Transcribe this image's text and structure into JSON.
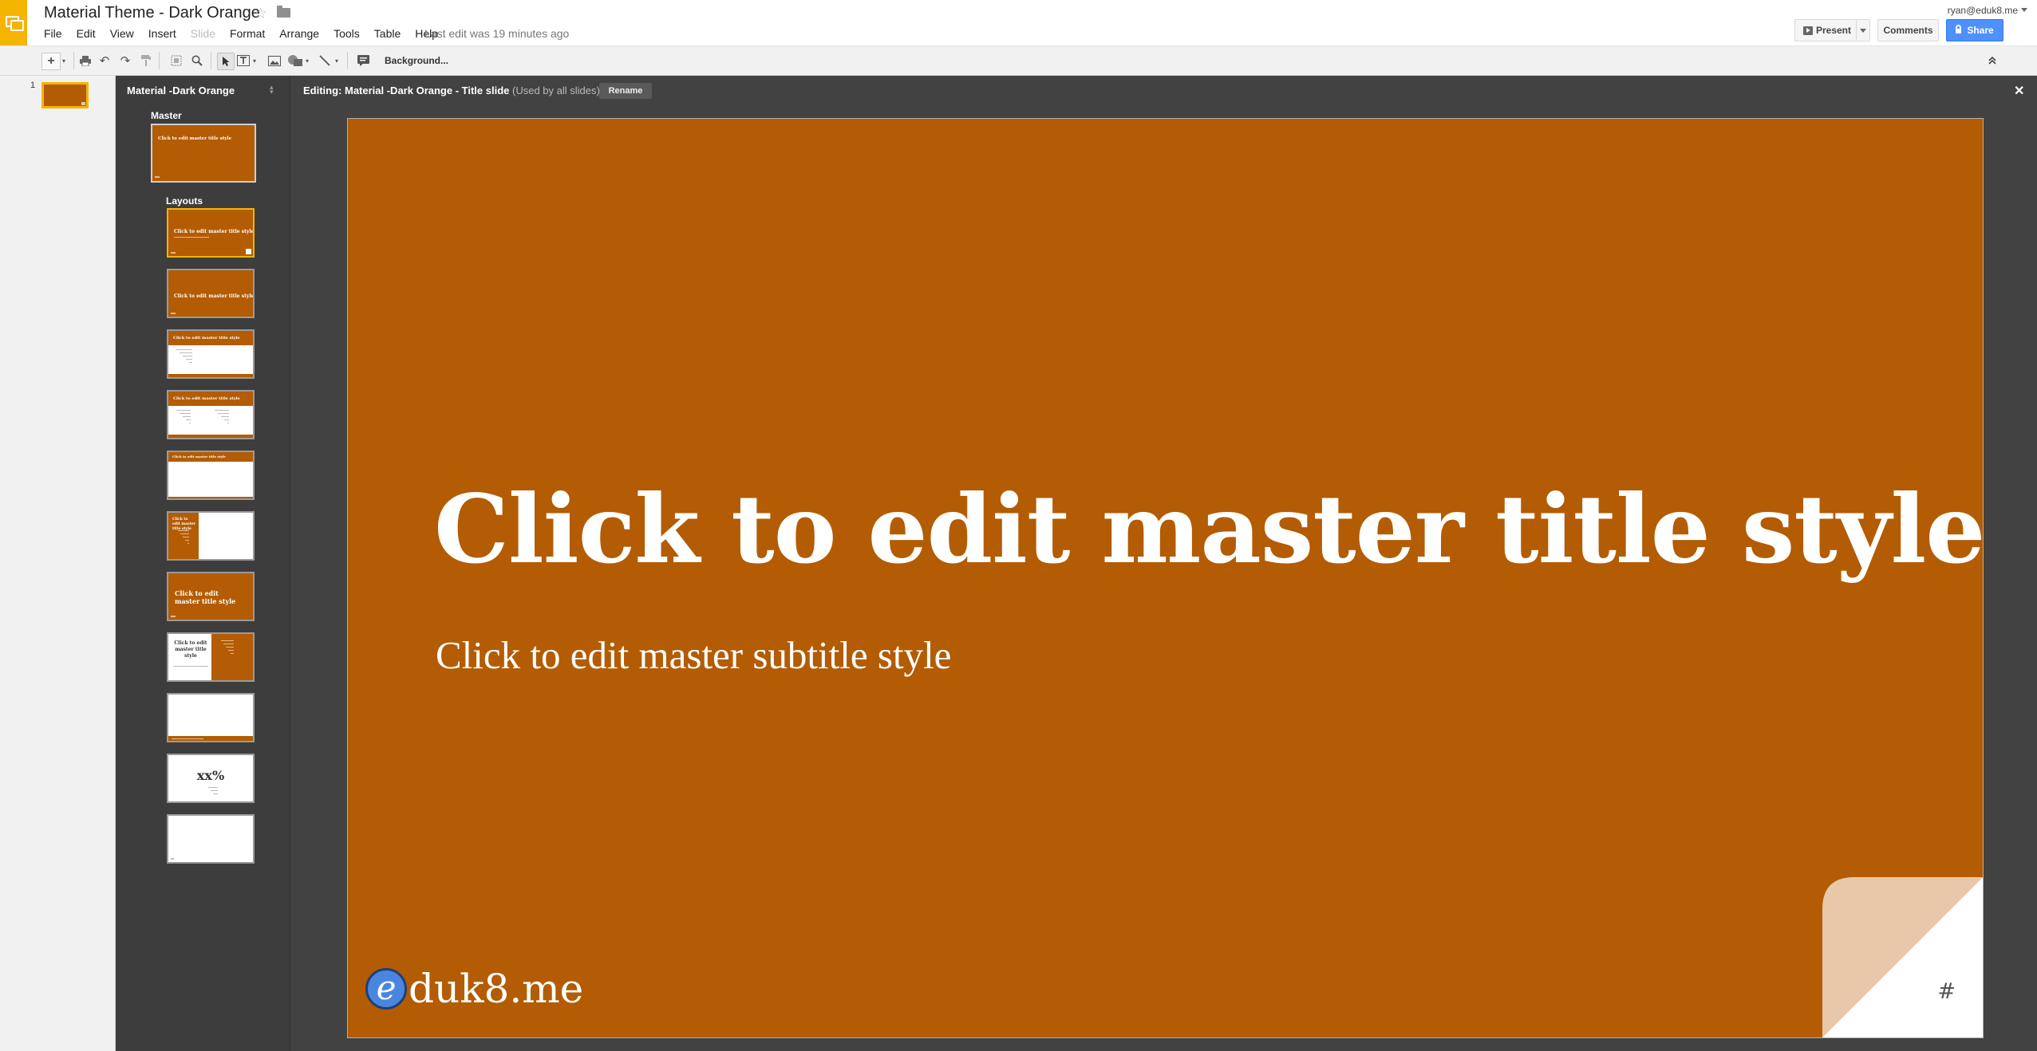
{
  "header": {
    "title": "Material Theme - Dark Orange",
    "menu": [
      "File",
      "Edit",
      "View",
      "Insert",
      "Slide",
      "Format",
      "Arrange",
      "Tools",
      "Table",
      "Help"
    ],
    "last_edit": "Last edit was 19 minutes ago",
    "account": "ryan@eduk8.me",
    "present_label": "Present",
    "comments_label": "Comments",
    "share_label": "Share",
    "accent_color": "#4d90fe"
  },
  "toolbar": {
    "new_slide": "+",
    "background_label": "Background..."
  },
  "filmstrip": {
    "slide_number": "1"
  },
  "master_panel": {
    "title": "Material -Dark Orange",
    "master_label": "Master",
    "layouts_label": "Layouts",
    "thumb_title": "Click to edit master title style",
    "thumb_title_short": "Click to edit master title style",
    "thumb_percent": "xx%",
    "thumb_split_title": "Click to edit master title style"
  },
  "editor": {
    "editing_prefix": "Editing: Material -Dark Orange - Title slide",
    "used_by": "(Used by all slides)",
    "rename_label": "Rename",
    "close_glyph": "✕"
  },
  "slide": {
    "title": "Click to edit master title style",
    "subtitle": "Click to edit master subtitle style",
    "logo_letter": "e",
    "logo_text": "duk8.me",
    "slide_number_placeholder": "#",
    "background_color": "#b35c04",
    "fold_color": "#e8c8a8"
  }
}
